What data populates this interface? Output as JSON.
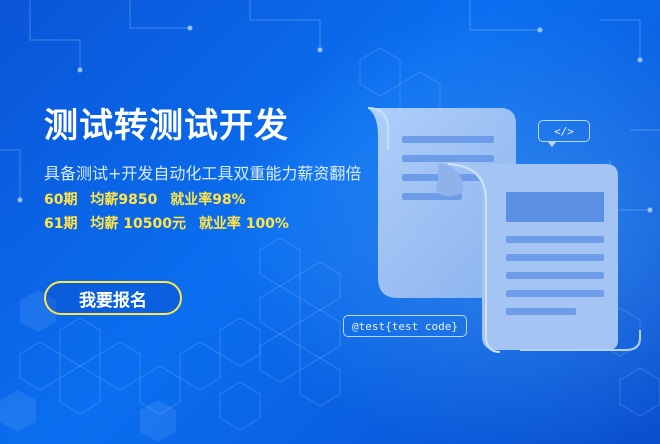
{
  "banner": {
    "title": "测试转测试开发",
    "subtitle": "具备测试+开发自动化工具双重能力薪资翻倍",
    "line1": {
      "period": "60期",
      "salary": "均薪9850",
      "employment": "就业率98%"
    },
    "line2": {
      "period": "61期",
      "salary": "均薪 10500元",
      "employment": "就业率 100%"
    },
    "cta_label": "我要报名",
    "code_tag": "</>",
    "test_tag": "@test{test code}"
  },
  "colors": {
    "background": "#0a5fe6",
    "accent_yellow": "#ffe54a",
    "document": "#a9c9f5",
    "document_bar": "#5a90e6"
  },
  "icons": [
    "document-icon",
    "code-bracket-icon"
  ]
}
